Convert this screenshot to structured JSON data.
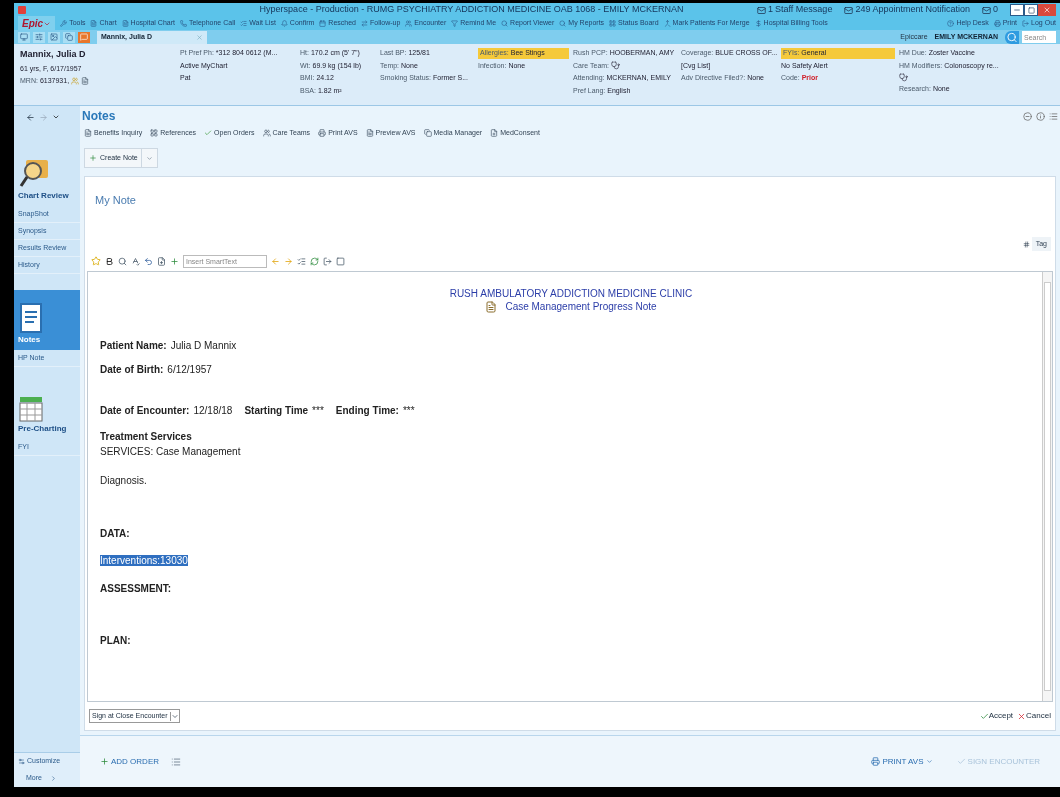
{
  "window": {
    "title": "Hyperspace - Production - RUMG PSYCHIATRY ADDICTION MEDICINE OAB 1068 - EMILY MCKERNAN",
    "notifications": [
      {
        "count": "1",
        "label": "Staff Message"
      },
      {
        "count": "249",
        "label": "Appointment Notification"
      },
      {
        "count": "0"
      }
    ]
  },
  "menu": {
    "brand": "Epic",
    "items": [
      "Tools",
      "Chart",
      "Hospital Chart",
      "Telephone Call",
      "Wait List",
      "Confirm",
      "Resched",
      "Follow-up",
      "Encounter",
      "Remind Me",
      "Report Viewer",
      "My Reports",
      "Status Board",
      "Mark Patients For Merge",
      "Hospital Billing Tools"
    ],
    "right_items": [
      "Help Desk",
      "Print",
      "Log Out"
    ]
  },
  "tabs": [
    {
      "label": "Mannix, Julia D",
      "selected": true
    }
  ],
  "user": {
    "app": "Epiccare",
    "name": "EMILY MCKERNAN"
  },
  "search": {
    "placeholder": "Search"
  },
  "patient": {
    "name": "Mannix, Julia D",
    "columns": [
      [
        {
          "value": "61 yrs, F, 6/17/1957"
        },
        {
          "label": "MRN:",
          "value": "6137931,"
        }
      ],
      [
        {
          "label": "Pt Pref Ph:",
          "value": "*312 804 0612 (M..."
        },
        {
          "value": "Active MyChart"
        },
        {
          "value": "Pat"
        }
      ],
      [
        {
          "label": "Ht:",
          "value": "170.2 cm (5' 7\")"
        },
        {
          "label": "Wt:",
          "value": "69.9 kg (154 lb)"
        },
        {
          "label": "BMI:",
          "value": "24.12"
        },
        {
          "label": "BSA:",
          "value": "1.82 m²"
        }
      ],
      [
        {
          "label": "Last BP:",
          "value": "125/81"
        },
        {
          "label": "Temp:",
          "value": "None"
        },
        {
          "label": "Smoking Status:",
          "value": "Former S..."
        }
      ],
      [
        {
          "label": "Allergies:",
          "value": "Bee Stings",
          "flag": true
        },
        {
          "label": "Infection:",
          "value": "None"
        }
      ],
      [
        {
          "label": "Rush PCP:",
          "value": "HOOBERMAN, AMY"
        },
        {
          "label": "Care Team:",
          "icon": true
        },
        {
          "label": "Attending:",
          "value": "MCKERNAN, EMILY"
        },
        {
          "label": "Pref Lang:",
          "value": "English"
        }
      ],
      [
        {
          "label": "Coverage:",
          "value": "BLUE CROSS OF..."
        },
        {
          "value": "[Cvg List]"
        },
        {
          "label": "Adv Directive Filed?:",
          "value": "None"
        }
      ],
      [
        {
          "label": "FYIs:",
          "value": "General",
          "flag": true
        },
        {
          "value": "No Safety Alert"
        },
        {
          "label": "Code:",
          "value": "Prior",
          "alert": true
        }
      ],
      [
        {
          "label": "HM Due:",
          "value": "Zoster Vaccine"
        },
        {
          "label": "HM Modifiers:",
          "value": "Colonoscopy re..."
        },
        {
          "icon": true
        },
        {
          "label": "Research:",
          "value": "None"
        }
      ]
    ]
  },
  "sidebar": {
    "items": [
      {
        "kind": "icon",
        "label": "Chart Review",
        "selected": false
      },
      {
        "kind": "link",
        "label": "SnapShot",
        "selected": false
      },
      {
        "kind": "link",
        "label": "Synopsis",
        "selected": false
      },
      {
        "kind": "link",
        "label": "Results Review",
        "selected": false
      },
      {
        "kind": "link",
        "label": "History",
        "selected": false
      },
      {
        "kind": "icon",
        "label": "Notes",
        "selected": true
      },
      {
        "kind": "link",
        "label": "HP Note",
        "selected": false
      },
      {
        "kind": "icon",
        "label": "Pre-Charting",
        "selected": false
      },
      {
        "kind": "link",
        "label": "FYI",
        "selected": false
      }
    ],
    "footer": [
      "Customize",
      "More"
    ]
  },
  "activity": {
    "title": "Notes",
    "toolbar": [
      "Benefits Inquiry",
      "References",
      "Open Orders",
      "Care Teams",
      "Print AVS",
      "Preview AVS",
      "Media Manager",
      "MedConsent"
    ],
    "create_button": "Create Note",
    "note": {
      "title": "My Note",
      "tag_button": "Tag",
      "smarttext_placeholder": "Insert SmartText",
      "lines": [
        {
          "kind": "clinic",
          "text": "RUSH AMBULATORY ADDICTION MEDICINE CLINIC"
        },
        {
          "kind": "doc_title",
          "text": "Case Management Progress Note"
        },
        {
          "kind": "fields",
          "items": [
            {
              "label": "Patient Name:",
              "value": "Julia D Mannix"
            }
          ]
        },
        {
          "kind": "fields",
          "items": [
            {
              "label": "Date of Birth:",
              "value": "6/12/1957"
            }
          ]
        },
        {
          "kind": "fields",
          "items": [
            {
              "label": "Date of Encounter:",
              "value": "12/18/18"
            },
            {
              "label": "Starting Time",
              "value": "***"
            },
            {
              "label": "Ending Time:",
              "value": "***"
            }
          ]
        },
        {
          "kind": "heading",
          "text": "Treatment Services"
        },
        {
          "kind": "text",
          "text": "SERVICES: Case Management"
        },
        {
          "kind": "text",
          "text": "Diagnosis."
        },
        {
          "kind": "heading",
          "text": "DATA:"
        },
        {
          "kind": "text",
          "text": "Interventions:13030",
          "selected": true
        },
        {
          "kind": "heading",
          "text": "ASSESSMENT:"
        },
        {
          "kind": "heading",
          "text": "PLAN:"
        }
      ],
      "sign_option": "Sign at Close Encounter",
      "accept": "Accept",
      "cancel": "Cancel"
    }
  },
  "bottom": {
    "add_order": "ADD ORDER",
    "print_avs": "PRINT AVS",
    "sign_encounter": "SIGN ENCOUNTER"
  }
}
